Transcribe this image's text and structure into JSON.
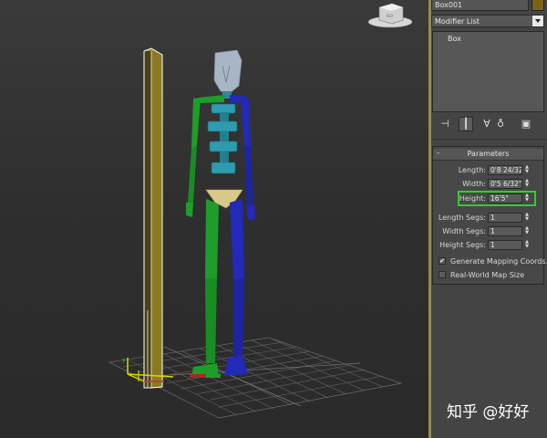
{
  "command_panel": {
    "object_name": "Box001",
    "object_color": "#7a6418",
    "modifier_list_label": "Modifier List",
    "stack_items": [
      "Box"
    ],
    "stack_tools": [
      "pin-stack-icon",
      "show-end-result-icon",
      "make-unique-icon",
      "remove-modifier-icon",
      "configure-modifier-sets-icon"
    ]
  },
  "parameters": {
    "title": "Parameters",
    "length_label": "Length:",
    "length_value": "0'8 24/32\"",
    "width_label": "Width:",
    "width_value": "0'5 6/32\"",
    "height_label": "Height:",
    "height_value": "16'5\"",
    "length_segs_label": "Length Segs:",
    "length_segs_value": "1",
    "width_segs_label": "Width Segs:",
    "width_segs_value": "1",
    "height_segs_label": "Height Segs:",
    "height_segs_value": "1",
    "generate_mapping_label": "Generate Mapping Coords.",
    "generate_mapping_checked": true,
    "real_world_label": "Real-World Map Size",
    "real_world_checked": false
  },
  "viewport": {
    "viewcube_label": "ISO"
  },
  "watermark": "知乎 @好好"
}
